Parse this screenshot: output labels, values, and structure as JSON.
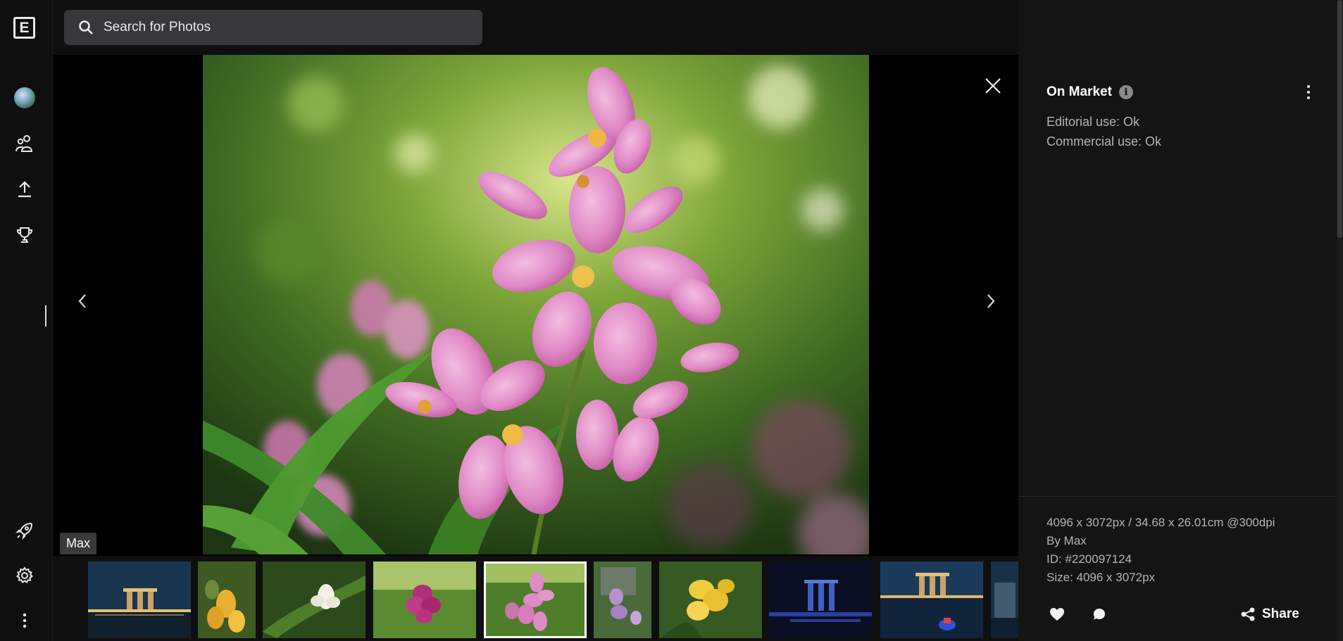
{
  "app": {
    "logo_letter": "E"
  },
  "search": {
    "placeholder": "Search for Photos"
  },
  "rail": {
    "items": [
      {
        "name": "profile-avatar"
      },
      {
        "name": "people-icon"
      },
      {
        "name": "upload-icon"
      },
      {
        "name": "trophy-icon"
      },
      {
        "name": "rocket-icon"
      },
      {
        "name": "gear-icon"
      },
      {
        "name": "more-vertical-icon"
      }
    ]
  },
  "tooltip": {
    "text": "Max"
  },
  "photo": {
    "subject": "pink orchids",
    "accent": "#e08ac6"
  },
  "filmstrip": {
    "selected_index": 4,
    "thumbs": [
      {
        "theme": "city-night"
      },
      {
        "theme": "yellow-orchid"
      },
      {
        "theme": "white-orchid"
      },
      {
        "theme": "magenta-orchid"
      },
      {
        "theme": "pink-orchid"
      },
      {
        "theme": "purple-orchid"
      },
      {
        "theme": "yellow-flowers"
      },
      {
        "theme": "city-night-blue"
      },
      {
        "theme": "city-night-boat"
      },
      {
        "theme": "city-partial"
      }
    ]
  },
  "panel": {
    "market_label": "On Market",
    "editorial": "Editorial use: Ok",
    "commercial": "Commercial use: Ok",
    "dimensions": "4096 x 3072px / 34.68 x 26.01cm @300dpi",
    "author": "By Max",
    "id": "ID: #220097124",
    "size": "Size: 4096 x 3072px",
    "share_label": "Share"
  },
  "colors": {
    "background": "#0f0f10",
    "panel": "#141415",
    "search": "#38383b"
  }
}
